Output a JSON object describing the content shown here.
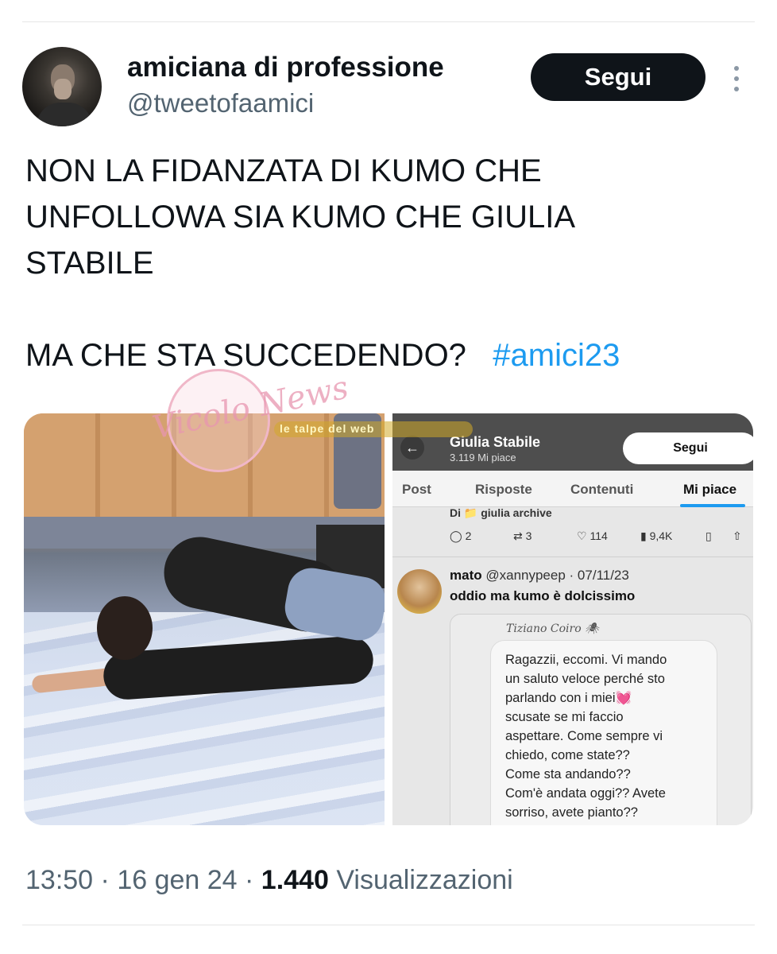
{
  "author": {
    "display_name": "amiciana di professione",
    "handle": "@tweetofaamici",
    "follow_label": "Segui"
  },
  "tweet": {
    "lines": [
      "NON LA FIDANZATA DI KUMO CHE",
      "UNFOLLOWA SIA KUMO CHE GIULIA",
      "STABILE",
      "",
      "MA CHE STA SUCCEDENDO?"
    ],
    "hashtag": "#amici23"
  },
  "media": {
    "screenshot": {
      "profile_name": "Giulia Stabile",
      "profile_likes": "3.119 Mi piace",
      "follow_label": "Segui",
      "tabs": [
        "Post",
        "Risposte",
        "Contenuti",
        "Mi piace"
      ],
      "active_tab": "Mi piace",
      "archive_line": "Di 📁 giulia archive",
      "actions": {
        "replies": "2",
        "retweets": "3",
        "likes": "114",
        "views": "9,4K"
      },
      "reply": {
        "name": "mato",
        "handle": "@xannypeep",
        "date": "· 07/11/23",
        "text": "oddio ma kumo è dolcissimo"
      },
      "quote": {
        "author": "Tiziano Coiro 🕷",
        "lines": [
          "Ragazzii, eccomi. Vi mando",
          "un saluto veloce perché sto",
          "parlando con i miei💓",
          "scusate se mi faccio",
          "aspettare. Come sempre vi",
          "chiedo, come state??",
          "Come sta andando??",
          "Com'è andata oggi?? Avete",
          "sorriso, avete pianto??"
        ]
      }
    },
    "watermarks": [
      "Vicolo News",
      "le talpe del web"
    ]
  },
  "meta": {
    "time": "13:50",
    "date": "16 gen 24",
    "views_count": "1.440",
    "views_label": "Visualizzazioni"
  },
  "icons": [
    "more-vertical-icon",
    "back-arrow-icon",
    "reply-icon",
    "retweet-icon",
    "heart-icon",
    "views-icon",
    "bookmark-icon",
    "share-icon"
  ]
}
